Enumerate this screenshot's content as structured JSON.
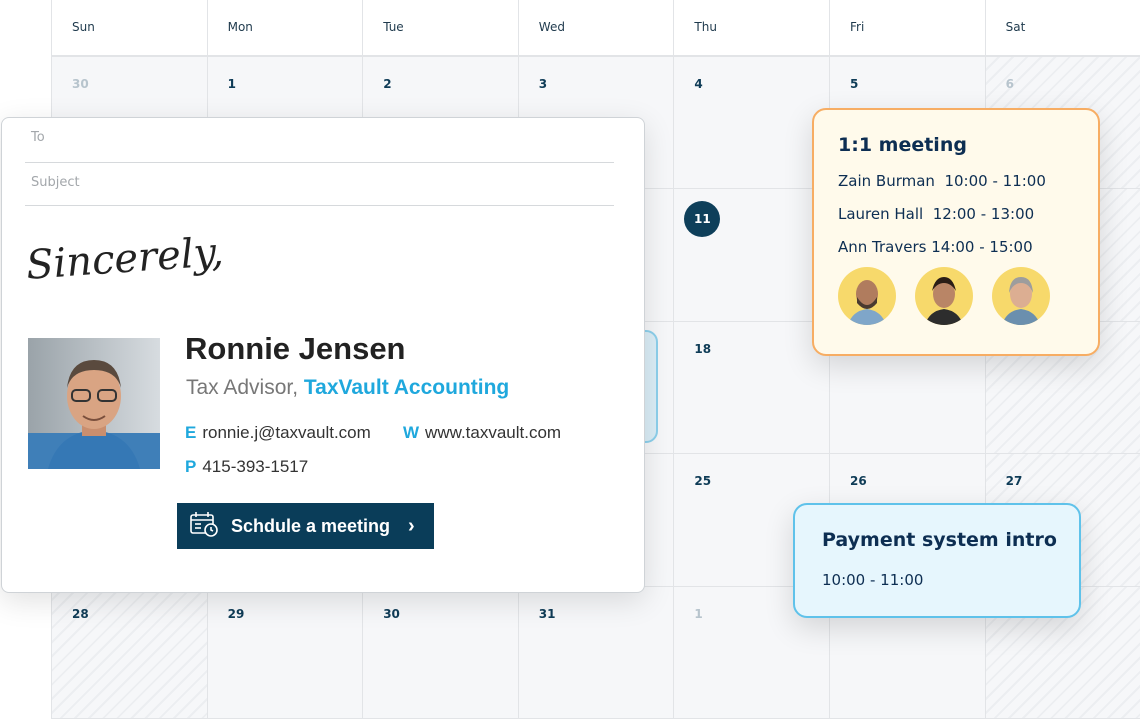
{
  "calendar": {
    "weekdays": [
      "Sun",
      "Mon",
      "Tue",
      "Wed",
      "Thu",
      "Fri",
      "Sat"
    ],
    "weeks": [
      [
        "30",
        "1",
        "2",
        "3",
        "4",
        "5",
        "6"
      ],
      [
        "",
        "",
        "",
        "",
        "11",
        "",
        ""
      ],
      [
        "",
        "",
        "",
        "",
        "18",
        "",
        ""
      ],
      [
        "",
        "",
        "",
        "",
        "25",
        "26",
        "27"
      ],
      [
        "28",
        "29",
        "30",
        "31",
        "1",
        "",
        ""
      ]
    ],
    "muted": [
      "0-0",
      "0-6",
      "4-4"
    ],
    "today": "11"
  },
  "email": {
    "to_placeholder": "To",
    "subject_placeholder": "Subject",
    "signoff": "Sincerely,",
    "name": "Ronnie Jensen",
    "title": "Tax Advisor,",
    "company": "TaxVault Accounting",
    "email_label": "E",
    "email": "ronnie.j@taxvault.com",
    "web_label": "W",
    "web": "www.taxvault.com",
    "phone_label": "P",
    "phone": "415-393-1517",
    "button": "Schdule a meeting"
  },
  "meeting": {
    "title": "1:1 meeting",
    "rows": [
      {
        "name": "Zain Burman",
        "time": "10:00 - 11:00"
      },
      {
        "name": "Lauren Hall",
        "time": "12:00 - 13:00"
      },
      {
        "name": "Ann Travers",
        "time": "14:00 - 15:00"
      }
    ]
  },
  "payment": {
    "title": "Payment system intro",
    "time": "10:00 - 11:00"
  },
  "colors": {
    "navy": "#0a3d59",
    "accent": "#1fa8dd",
    "meeting_border": "#f7ad63",
    "payment_border": "#5fc2ea"
  }
}
